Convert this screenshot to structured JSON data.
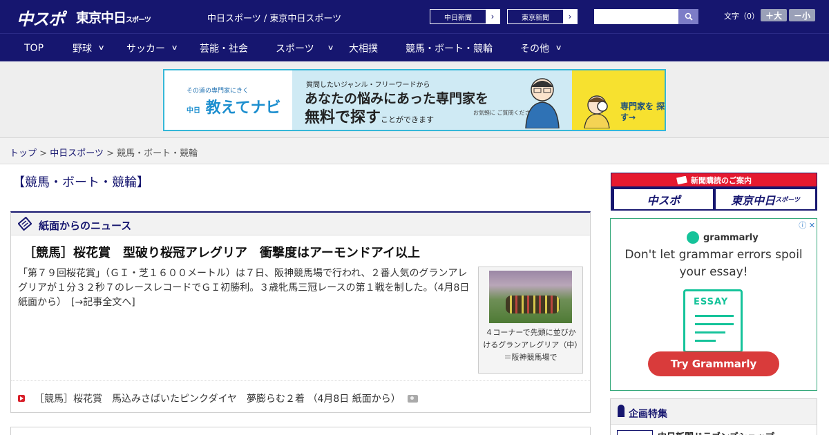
{
  "header": {
    "logo_chunichi_sports": "中スポ",
    "logo_tokyo_chunichi": "東京中日",
    "logo_tokyo_chunichi_small": "スポーツ",
    "subtitle": "中日スポーツ / 東京中日スポーツ",
    "links": [
      {
        "label": "中日新聞"
      },
      {
        "label": "東京新聞"
      }
    ],
    "search": {
      "placeholder": ""
    },
    "font_size_label": "文字（0）",
    "font_larger": "＋大",
    "font_smaller": "－小"
  },
  "nav": {
    "items": [
      {
        "label": "TOP",
        "dropdown": false
      },
      {
        "label": "野球",
        "dropdown": true
      },
      {
        "label": "サッカー",
        "dropdown": true
      },
      {
        "label": "芸能・社会",
        "dropdown": false
      },
      {
        "label": "スポーツ",
        "dropdown": true
      },
      {
        "label": "大相撲",
        "dropdown": false
      },
      {
        "label": "競馬・ボート・競輪",
        "dropdown": false
      },
      {
        "label": "その他",
        "dropdown": true
      }
    ]
  },
  "banner": {
    "small_text": "その道の専門家にきく",
    "brand_prefix": "中日",
    "brand": "教えてナビ",
    "line1": "質問したいジャンル・フリーワードから",
    "line2": "あなたの悩みにあった専門家を",
    "line3_bold": "無料で探す",
    "line3_small": "ことができます",
    "note": "お気軽に ご質問ください!",
    "cta": "専門家を 探す→"
  },
  "breadcrumb": {
    "items": [
      {
        "label": "トップ",
        "link": true
      },
      {
        "label": "中日スポーツ",
        "link": true
      },
      {
        "label": "競馬・ボート・競輪",
        "link": false
      }
    ],
    "separator": ">"
  },
  "page_heading": "【競馬・ボート・競輪】",
  "news_section": {
    "title": "紙面からのニュース",
    "headline": "［競馬］桜花賞　型破り桜冠アレグリア　衝撃度はアーモンドアイ以上",
    "lead": "「第７９回桜花賞」（ＧＩ・芝１６００メートル）は７日、阪神競馬場で行われ、２番人気のグランアレグリアが１分３２秒７のレースレコードでＧＩ初勝利。３歳牝馬三冠レースの第１戦を制した。（4月8日 紙面から）　[→記事全文へ]",
    "photo_caption": "４コーナーで先頭に並びかけるグランアレグリア（中）＝阪神競馬場で",
    "sub_news": "［競馬］桜花賞　馬込みさばいたピンクダイヤ　夢膨らむ２着 （4月8日 紙面から）"
  },
  "sidebar": {
    "subscription_header": "新聞購読のご案内",
    "subscription_logo1": "中スポ",
    "subscription_logo2": "東京中日",
    "subscription_logo2_small": "スポーツ",
    "ad": {
      "brand": "grammarly",
      "text": "Don't let grammar errors spoil your essay!",
      "doc_label": "ESSAY",
      "cta": "Try Grammarly"
    },
    "feature": {
      "title": "企画特集",
      "item": "中日新聞ドラゴンズショップ"
    }
  },
  "colors": {
    "navy": "#16166f",
    "red": "#e5192f",
    "banner_border": "#34b7d8",
    "grammarly_green": "#15c39a"
  }
}
